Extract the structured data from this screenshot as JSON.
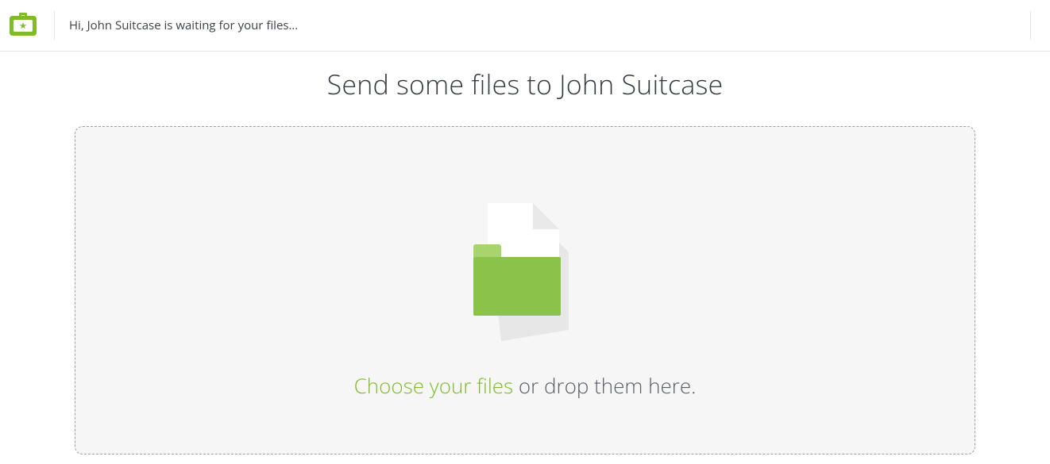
{
  "header": {
    "greeting": "Hi, John Suitcase is waiting for your files…"
  },
  "main": {
    "title": "Send some files to John Suitcase",
    "dropzone": {
      "choose_label": "Choose your files",
      "drop_label": " or drop them here."
    }
  },
  "colors": {
    "accent": "#82bb2a"
  }
}
